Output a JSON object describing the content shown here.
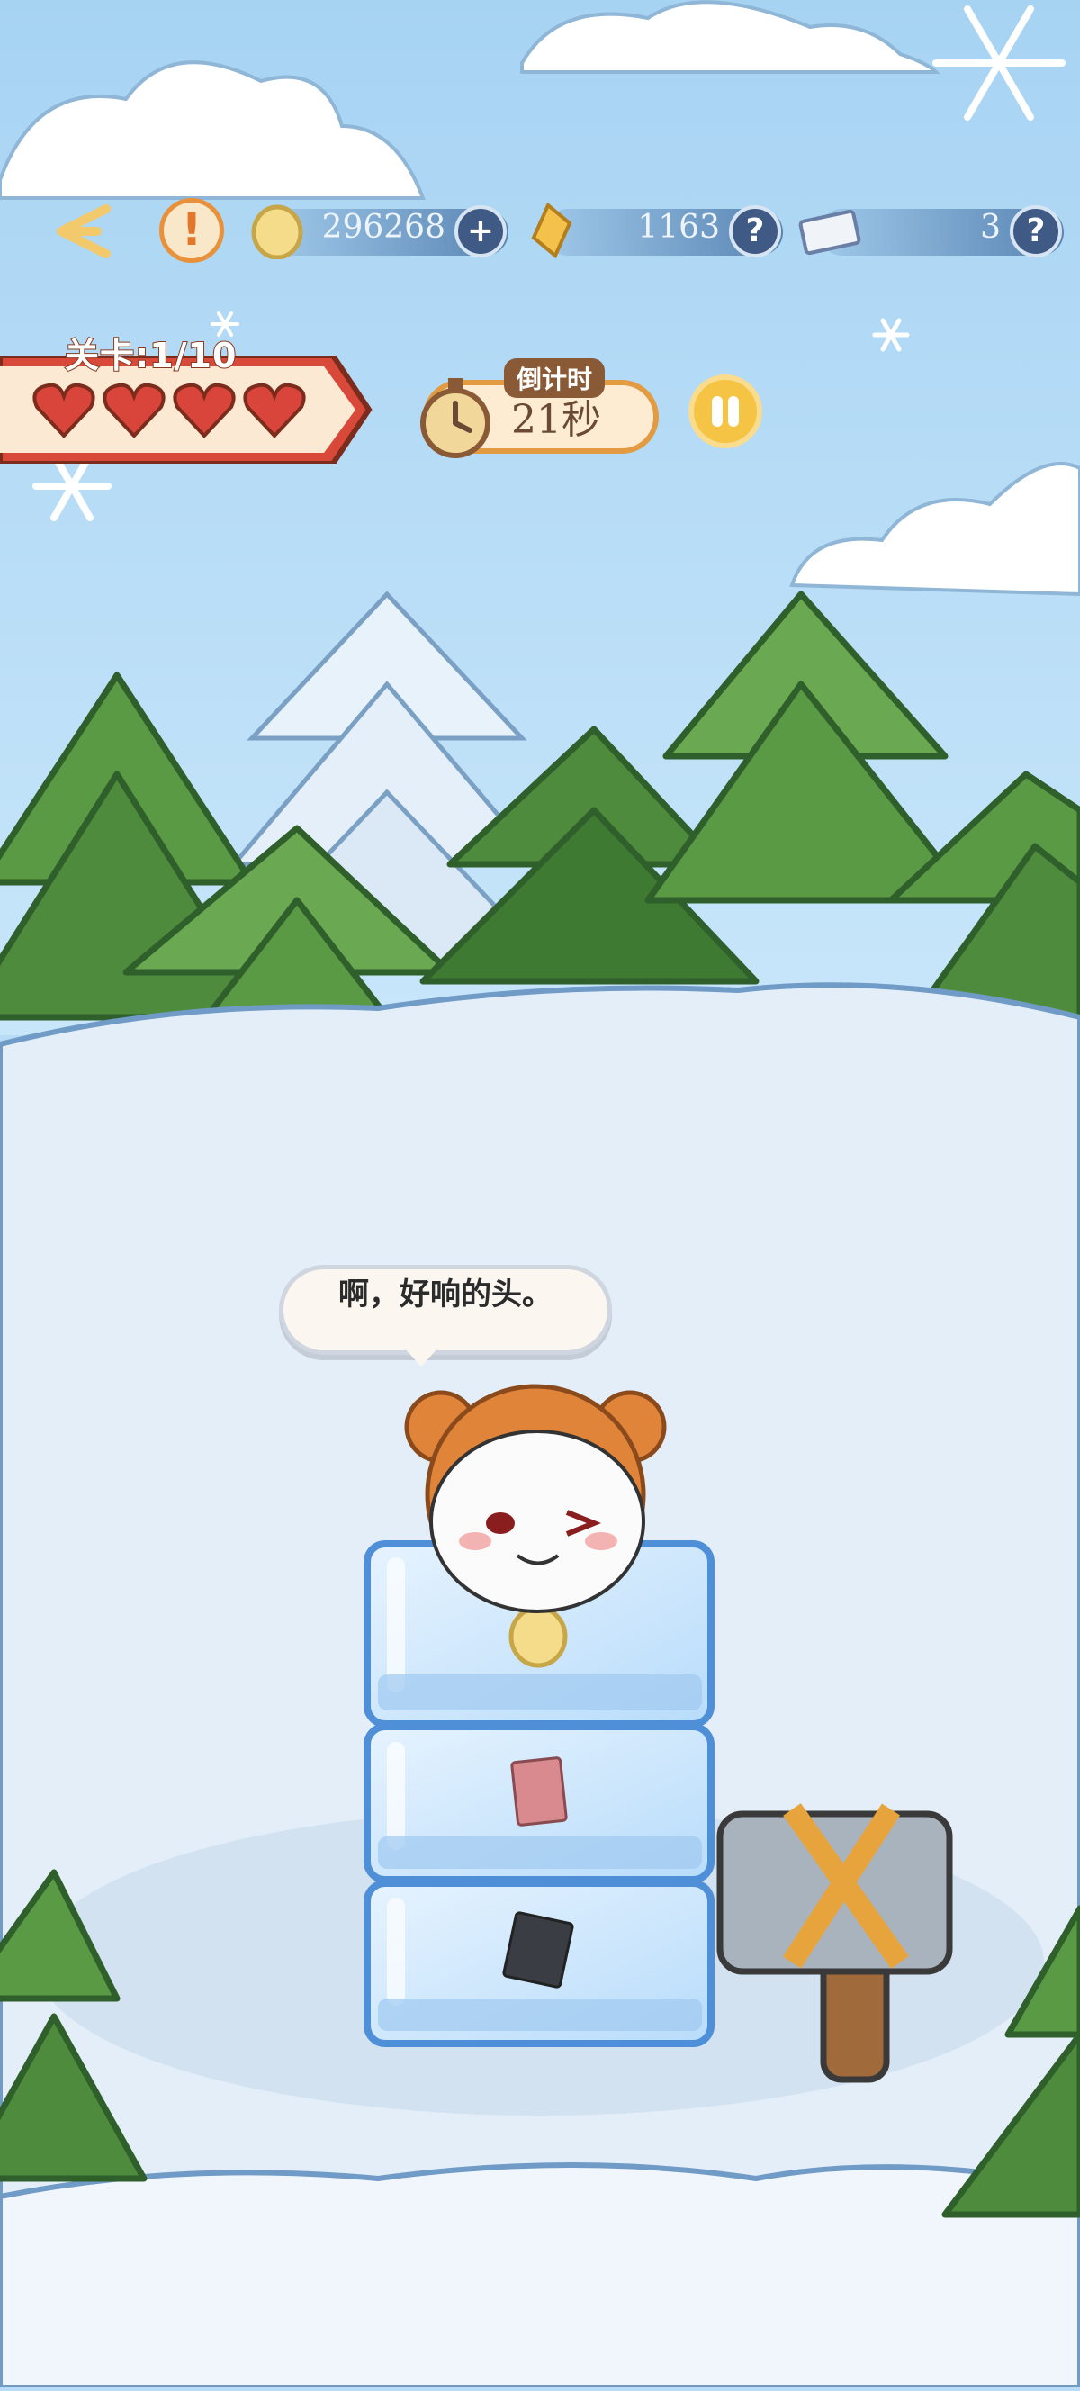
{
  "hud": {
    "coins": "296268",
    "gems": "1163",
    "tickets": "3",
    "plus_label": "+",
    "help_label": "?",
    "alert_label": "!"
  },
  "level": {
    "label": "关卡:1/10",
    "hearts": 4
  },
  "timer": {
    "title": "倒计时",
    "value": "21秒"
  },
  "dialog": {
    "text": "啊，好响的头。"
  },
  "colors": {
    "sky": "#b8dcf5",
    "snow": "#e4eef8",
    "tree": "#5f9b47",
    "ice": "#c9e4fb",
    "accent_orange": "#e39b41"
  },
  "icons": [
    "back-arrow-icon",
    "alert-icon",
    "coin-icon",
    "crystal-icon",
    "ticket-icon",
    "heart-icon",
    "clock-icon",
    "pause-icon",
    "hammer-icon"
  ]
}
